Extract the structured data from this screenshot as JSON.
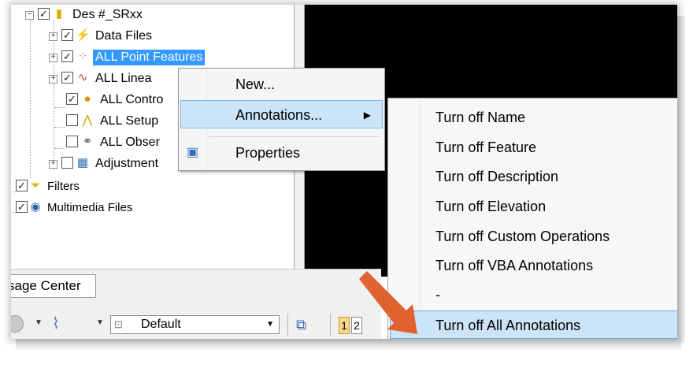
{
  "tree": {
    "nodes": [
      {
        "label": "Des #_SRxx",
        "checked": true,
        "icon": "folder-icon"
      },
      {
        "label": "Data Files",
        "checked": true,
        "icon": "data-files-icon"
      },
      {
        "label": "ALL Point Features",
        "checked": true,
        "icon": "point-features-icon"
      },
      {
        "label": "ALL Linea",
        "checked": true,
        "icon": "linear-features-icon"
      },
      {
        "label": "ALL Contro",
        "checked": true,
        "icon": "control-icon"
      },
      {
        "label": "ALL Setup",
        "checked": false,
        "icon": "setup-icon"
      },
      {
        "label": "ALL Obser",
        "checked": false,
        "icon": "observations-icon"
      },
      {
        "label": "Adjustment",
        "checked": false,
        "icon": "adjustment-icon"
      },
      {
        "label": "Filters",
        "checked": true,
        "icon": "filters-icon"
      },
      {
        "label": "Multimedia Files",
        "checked": true,
        "icon": "multimedia-icon"
      }
    ]
  },
  "bottom": {
    "tab_label": "sage Center",
    "toolbar": {
      "layer_select_value": "Default",
      "page_buttons": [
        "1",
        "2"
      ]
    }
  },
  "context_menu": {
    "items": [
      {
        "label": "New..."
      },
      {
        "label": "Annotations..."
      },
      {
        "label": "Properties"
      }
    ]
  },
  "submenu": {
    "items": [
      {
        "label": "Turn off Name"
      },
      {
        "label": "Turn off Feature"
      },
      {
        "label": "Turn off Description"
      },
      {
        "label": "Turn off Elevation"
      },
      {
        "label": "Turn off Custom Operations"
      },
      {
        "label": "Turn off VBA Annotations"
      },
      {
        "label": "-"
      },
      {
        "label": "Turn off All Annotations"
      }
    ]
  },
  "colors": {
    "selection_blue": "#3399ff",
    "menu_highlight": "#cce4f7",
    "arrow_orange": "#e0622e"
  }
}
